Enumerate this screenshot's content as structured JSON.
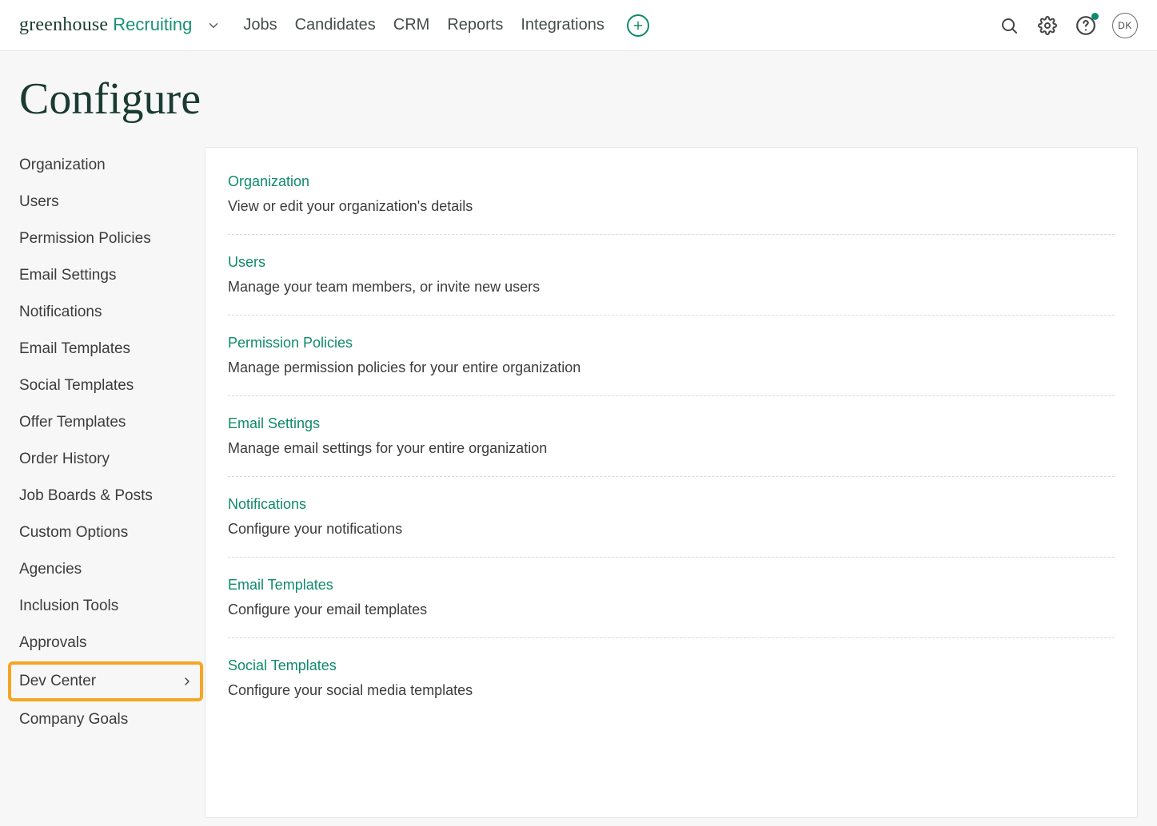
{
  "brand": {
    "name": "greenhouse",
    "product": "Recruiting"
  },
  "nav": {
    "items": [
      "Jobs",
      "Candidates",
      "CRM",
      "Reports",
      "Integrations"
    ]
  },
  "user": {
    "initials": "DK"
  },
  "page": {
    "title": "Configure"
  },
  "sidebar": {
    "items": [
      {
        "label": "Organization"
      },
      {
        "label": "Users"
      },
      {
        "label": "Permission Policies"
      },
      {
        "label": "Email Settings"
      },
      {
        "label": "Notifications"
      },
      {
        "label": "Email Templates"
      },
      {
        "label": "Social Templates"
      },
      {
        "label": "Offer Templates"
      },
      {
        "label": "Order History"
      },
      {
        "label": "Job Boards & Posts"
      },
      {
        "label": "Custom Options"
      },
      {
        "label": "Agencies"
      },
      {
        "label": "Inclusion Tools"
      },
      {
        "label": "Approvals"
      },
      {
        "label": "Dev Center",
        "has_submenu": true,
        "highlighted": true
      },
      {
        "label": "Company Goals"
      }
    ]
  },
  "sections": [
    {
      "title": "Organization",
      "desc": "View or edit your organization's details"
    },
    {
      "title": "Users",
      "desc": "Manage your team members, or invite new users"
    },
    {
      "title": "Permission Policies",
      "desc": "Manage permission policies for your entire organization"
    },
    {
      "title": "Email Settings",
      "desc": "Manage email settings for your entire organization"
    },
    {
      "title": "Notifications",
      "desc": "Configure your notifications"
    },
    {
      "title": "Email Templates",
      "desc": "Configure your email templates"
    },
    {
      "title": "Social Templates",
      "desc": "Configure your social media templates"
    }
  ]
}
